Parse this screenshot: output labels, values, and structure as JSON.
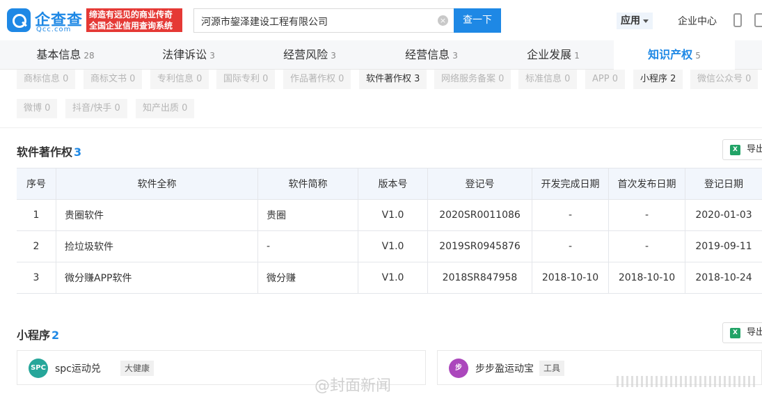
{
  "header": {
    "logo_name": "企查查",
    "logo_domain": "Qcc.com",
    "slogan_line1": "缔造有远见的商业传奇",
    "slogan_line2": "全国企业信用查询系统",
    "search_value": "河源市鋆泽建设工程有限公司",
    "search_button": "查一下",
    "app_label": "应用",
    "center_label": "企业中心"
  },
  "main_tabs": [
    {
      "label": "基本信息",
      "count": "28"
    },
    {
      "label": "法律诉讼",
      "count": "3"
    },
    {
      "label": "经营风险",
      "count": "3"
    },
    {
      "label": "经营信息",
      "count": "3"
    },
    {
      "label": "企业发展",
      "count": "1"
    },
    {
      "label": "知识产权",
      "count": "5",
      "active": true
    }
  ],
  "sub_tabs": [
    {
      "label": "商标信息 0"
    },
    {
      "label": "商标文书 0"
    },
    {
      "label": "专利信息 0"
    },
    {
      "label": "国际专利 0"
    },
    {
      "label": "作品著作权 0"
    },
    {
      "label": "软件著作权 3",
      "on": true
    },
    {
      "label": "网络服务备案 0"
    },
    {
      "label": "标准信息 0"
    },
    {
      "label": "APP 0"
    },
    {
      "label": "小程序 2",
      "on": true
    },
    {
      "label": "微信公众号 0"
    },
    {
      "label": "微博 0"
    },
    {
      "label": "抖音/快手 0"
    },
    {
      "label": "知产出质 0"
    }
  ],
  "software": {
    "title": "软件著作权",
    "count": "3",
    "export_label": "导出",
    "columns": [
      "序号",
      "软件全称",
      "软件简称",
      "版本号",
      "登记号",
      "开发完成日期",
      "首次发布日期",
      "登记日期"
    ],
    "rows": [
      [
        "1",
        "贵圈软件",
        "贵圈",
        "V1.0",
        "2020SR0011086",
        "-",
        "-",
        "2020-01-03"
      ],
      [
        "2",
        "捡垃圾软件",
        "-",
        "V1.0",
        "2019SR0945876",
        "-",
        "-",
        "2019-09-11"
      ],
      [
        "3",
        "微分赚APP软件",
        "微分赚",
        "V1.0",
        "2018SR847958",
        "2018-10-10",
        "2018-10-10",
        "2018-10-24"
      ]
    ]
  },
  "mini_programs": {
    "title": "小程序",
    "count": "2",
    "export_label": "导出",
    "items": [
      {
        "name": "spc运动兑",
        "tag": "大健康",
        "icon_color": "#26a69a"
      },
      {
        "name": "步步盈运动宝",
        "tag": "工具",
        "icon_color": "#ab47bc"
      }
    ]
  },
  "watermark": "@封面新闻"
}
